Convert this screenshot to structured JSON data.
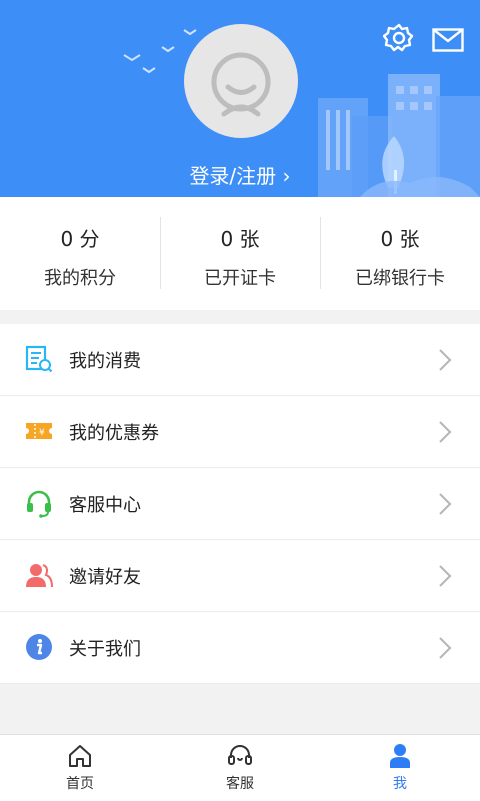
{
  "header": {
    "login_label": "登录/注册",
    "chevron": "›",
    "settings_icon": "gear-icon",
    "message_icon": "mail-icon",
    "bg_color": "#3d8ef7"
  },
  "stats": [
    {
      "value": "0 分",
      "label": "我的积分"
    },
    {
      "value": "0 张",
      "label": "已开证卡"
    },
    {
      "value": "0 张",
      "label": "已绑银行卡"
    }
  ],
  "menu": [
    {
      "label": "我的消费",
      "icon": "receipt-icon",
      "color": "#29b6f6"
    },
    {
      "label": "我的优惠券",
      "icon": "coupon-icon",
      "color": "#f6a623"
    },
    {
      "label": "客服中心",
      "icon": "headset-icon",
      "color": "#3bbf4b"
    },
    {
      "label": "邀请好友",
      "icon": "invite-friends-icon",
      "color": "#f26a6a"
    },
    {
      "label": "关于我们",
      "icon": "info-icon",
      "color": "#4e86e8"
    }
  ],
  "tabs": [
    {
      "label": "首页",
      "icon": "home-icon",
      "active": false
    },
    {
      "label": "客服",
      "icon": "headset-icon",
      "active": false
    },
    {
      "label": "我",
      "icon": "person-icon",
      "active": true
    }
  ],
  "accent_color": "#2f7df6"
}
